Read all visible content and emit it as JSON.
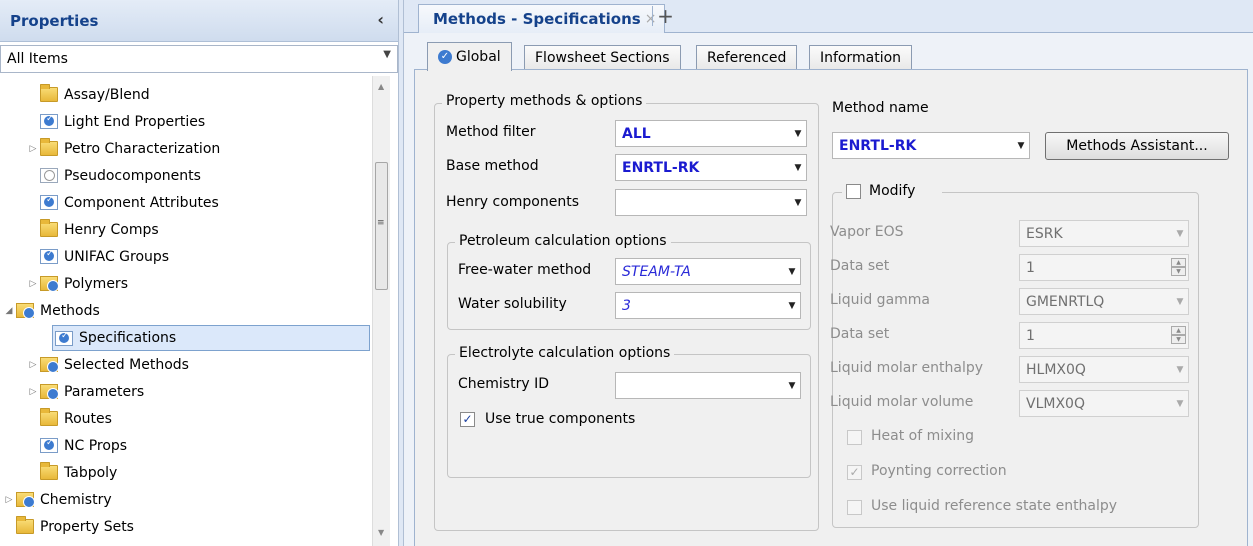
{
  "properties_panel": {
    "title": "Properties",
    "collapse_glyph": "‹",
    "filter_value": "All Items",
    "tree": [
      {
        "label": "Assay/Blend",
        "icon": "folder-icon"
      },
      {
        "label": "Light End Properties",
        "icon": "check-sheet-icon"
      },
      {
        "label": "Petro Characterization",
        "icon": "folder-icon"
      },
      {
        "label": "Pseudocomponents",
        "icon": "empty-sheet-icon"
      },
      {
        "label": "Component Attributes",
        "icon": "check-sheet-icon"
      },
      {
        "label": "Henry Comps",
        "icon": "folder-icon"
      },
      {
        "label": "UNIFAC Groups",
        "icon": "check-sheet-icon"
      },
      {
        "label": "Polymers",
        "icon": "checked-folder-icon"
      },
      {
        "label": "Methods",
        "icon": "checked-folder-icon"
      },
      {
        "label": "Specifications",
        "icon": "check-sheet-icon"
      },
      {
        "label": "Selected Methods",
        "icon": "checked-folder-icon"
      },
      {
        "label": "Parameters",
        "icon": "checked-folder-icon"
      },
      {
        "label": "Routes",
        "icon": "folder-icon"
      },
      {
        "label": "NC Props",
        "icon": "check-sheet-icon"
      },
      {
        "label": "Tabpoly",
        "icon": "folder-icon"
      },
      {
        "label": "Chemistry",
        "icon": "checked-folder-icon"
      },
      {
        "label": "Property Sets",
        "icon": "folder-icon"
      }
    ]
  },
  "document": {
    "tab_title": "Methods - Specifications",
    "close_glyph": "×",
    "add_glyph": "+",
    "inner_tabs": [
      "Global",
      "Flowsheet Sections",
      "Referenced",
      "Information"
    ],
    "active_tab": "Global"
  },
  "form": {
    "property_group": {
      "legend": "Property methods & options",
      "method_filter_label": "Method filter",
      "method_filter_value": "ALL",
      "base_method_label": "Base method",
      "base_method_value": "ENRTL-RK",
      "henry_label": "Henry components",
      "henry_value": ""
    },
    "petroleum_group": {
      "legend": "Petroleum calculation options",
      "free_water_label": "Free-water method",
      "free_water_value": "STEAM-TA",
      "water_solubility_label": "Water solubility",
      "water_solubility_value": "3"
    },
    "electrolyte_group": {
      "legend": "Electrolyte calculation options",
      "chemistry_id_label": "Chemistry ID",
      "chemistry_id_value": "",
      "use_true_label": "Use true components",
      "use_true_checked": true
    },
    "method_name": {
      "label": "Method name",
      "value": "ENRTL-RK",
      "assistant_button": "Methods Assistant..."
    },
    "modify_group": {
      "legend": "Modify",
      "checked": false,
      "vapor_eos_label": "Vapor EOS",
      "vapor_eos_value": "ESRK",
      "data_set_label_1": "Data set",
      "data_set_value_1": "1",
      "liquid_gamma_label": "Liquid gamma",
      "liquid_gamma_value": "GMENRTLQ",
      "data_set_label_2": "Data set",
      "data_set_value_2": "1",
      "liq_enthalpy_label": "Liquid molar enthalpy",
      "liq_enthalpy_value": "HLMX0Q",
      "liq_volume_label": "Liquid molar volume",
      "liq_volume_value": "VLMX0Q",
      "heat_mixing_label": "Heat of mixing",
      "heat_mixing_checked": false,
      "poynting_label": "Poynting correction",
      "poynting_checked": true,
      "liq_ref_label": "Use liquid reference state enthalpy",
      "liq_ref_checked": false
    }
  },
  "colors": {
    "header_text": "#15428b",
    "value_blue": "#1b1bd0"
  }
}
